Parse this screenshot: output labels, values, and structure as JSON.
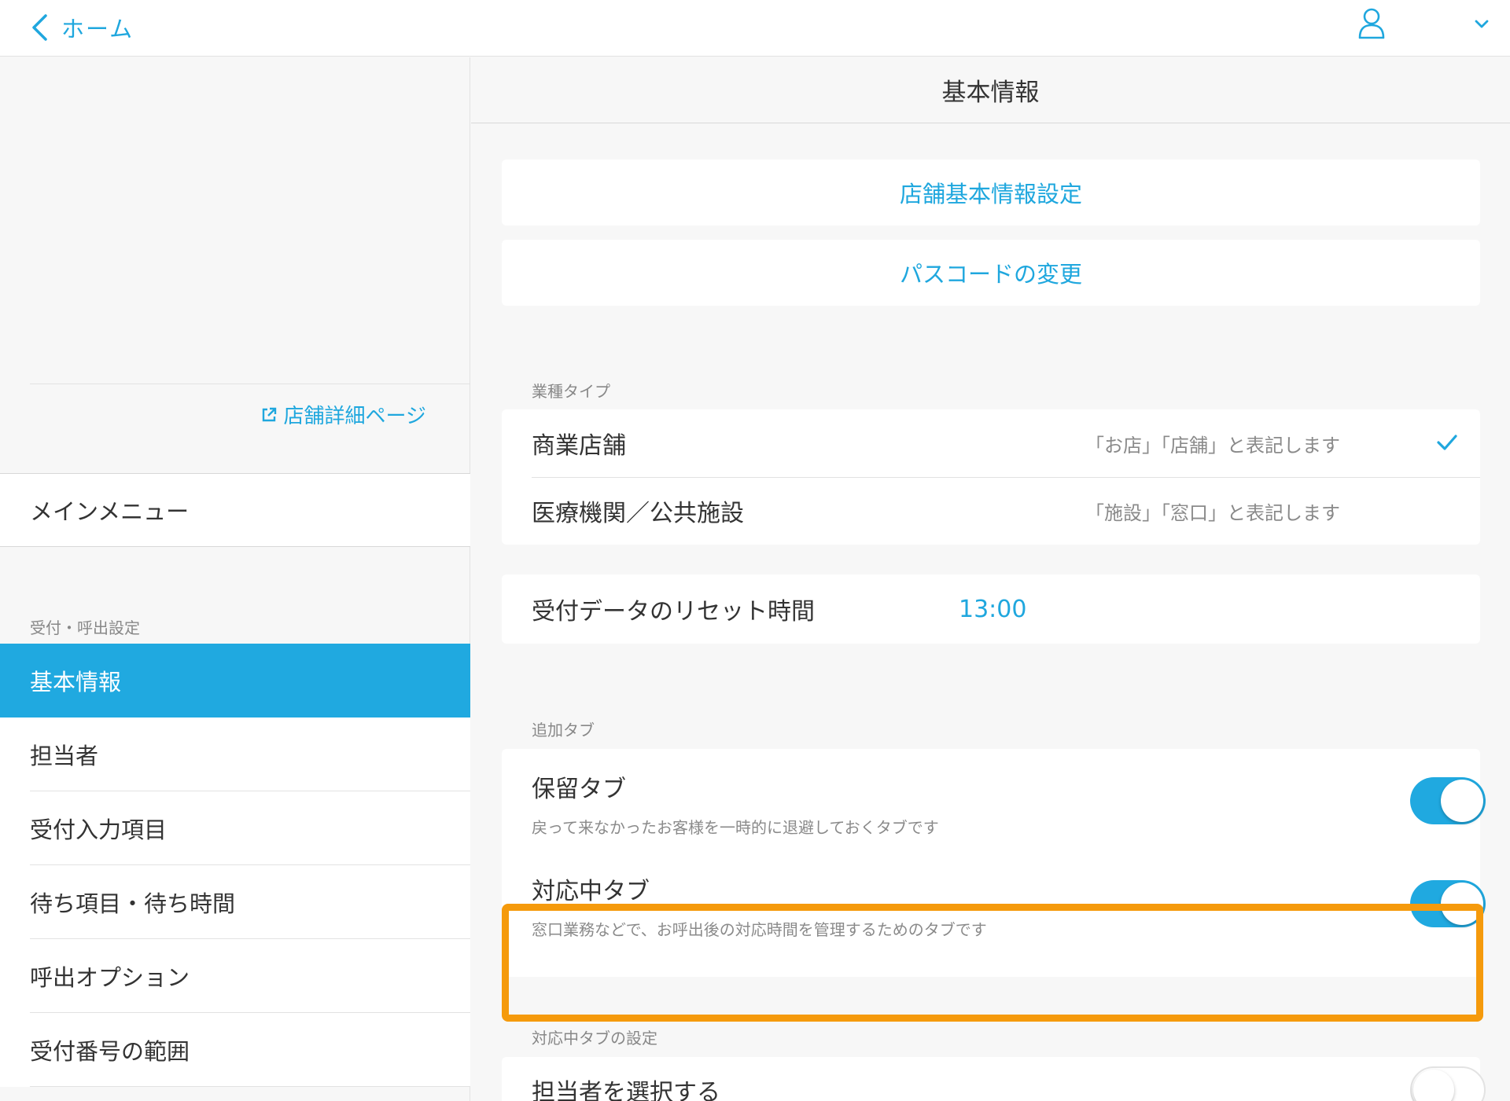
{
  "topbar": {
    "back_label": "ホーム",
    "icons": [
      "chevron-left-icon",
      "user-icon",
      "chevron-down-icon"
    ]
  },
  "sidebar": {
    "shop_link": "店舗詳細ページ",
    "main_menu": "メインメニュー",
    "section_caption": "受付・呼出設定",
    "items": [
      {
        "label": "基本情報",
        "active": true
      },
      {
        "label": "担当者"
      },
      {
        "label": "受付入力項目"
      },
      {
        "label": "待ち項目・待ち時間"
      },
      {
        "label": "呼出オプション"
      },
      {
        "label": "受付番号の範囲"
      }
    ]
  },
  "main": {
    "title": "基本情報",
    "buttons": {
      "store_settings": "店舗基本情報設定",
      "passcode": "パスコードの変更"
    },
    "business_type": {
      "caption": "業種タイプ",
      "options": [
        {
          "label": "商業店舗",
          "desc": "「お店」「店舗」と表記します",
          "selected": true
        },
        {
          "label": "医療機関／公共施設",
          "desc": "「施設」「窓口」と表記します",
          "selected": false
        }
      ]
    },
    "reset": {
      "label": "受付データのリセット時間",
      "value": "13:00"
    },
    "extra_tabs": {
      "caption": "追加タブ",
      "hold": {
        "title": "保留タブ",
        "sub": "戻って来なかったお客様を一時的に退避しておくタブです",
        "on": true
      },
      "active": {
        "title": "対応中タブ",
        "sub": "窓口業務などで、お呼出後の対応時間を管理するためのタブです",
        "on": true
      }
    },
    "active_tab_settings": {
      "caption": "対応中タブの設定",
      "select_staff": {
        "title": "担当者を選択する",
        "on": false
      }
    }
  },
  "colors": {
    "accent": "#20a9e0",
    "highlight": "#f59a0c"
  }
}
